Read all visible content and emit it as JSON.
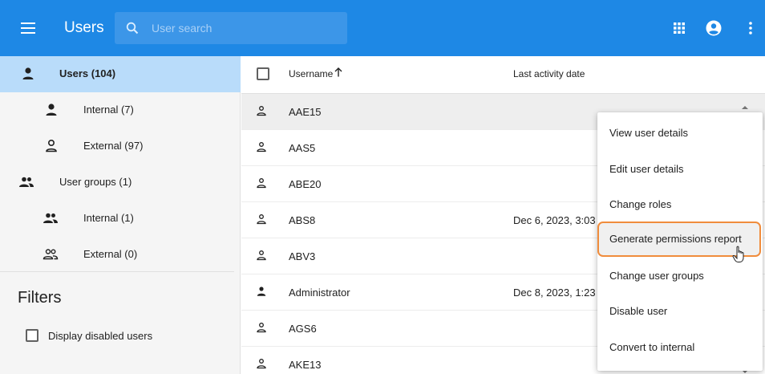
{
  "appbar": {
    "title": "Users",
    "search_placeholder": "User search"
  },
  "sidebar": {
    "items": [
      {
        "label": "Users (104)"
      },
      {
        "label": "Internal (7)"
      },
      {
        "label": "External (97)"
      },
      {
        "label": "User groups (1)"
      },
      {
        "label": "Internal (1)"
      },
      {
        "label": "External (0)"
      }
    ],
    "filters_title": "Filters",
    "filter_disabled_label": "Display disabled users"
  },
  "table": {
    "header_username": "Username",
    "header_activity": "Last activity date",
    "rows": [
      {
        "username": "AAE15",
        "date": ""
      },
      {
        "username": "AAS5",
        "date": ""
      },
      {
        "username": "ABE20",
        "date": ""
      },
      {
        "username": "ABS8",
        "date": "Dec 6, 2023, 3:03"
      },
      {
        "username": "ABV3",
        "date": ""
      },
      {
        "username": "Administrator",
        "date": "Dec 8, 2023, 1:23"
      },
      {
        "username": "AGS6",
        "date": ""
      },
      {
        "username": "AKE13",
        "date": ""
      }
    ]
  },
  "context_menu": {
    "items": [
      {
        "label": "View user details"
      },
      {
        "label": "Edit user details"
      },
      {
        "label": "Change roles"
      },
      {
        "label": "Generate permissions report"
      },
      {
        "label": "Change user groups"
      },
      {
        "label": "Disable user"
      },
      {
        "label": "Convert to internal"
      }
    ]
  },
  "colors": {
    "appbar": "#1e88e5",
    "sidebar_active": "#b9dcfa",
    "highlight_border": "#f08c3c"
  },
  "icons": {
    "menu": "hamburger-icon",
    "search": "search-icon",
    "apps": "apps-grid-icon",
    "account": "account-circle-icon",
    "more": "more-vert-icon",
    "person_filled": "person-icon",
    "person_outline": "person-outline-icon",
    "group": "group-icon",
    "group_outline": "group-outline-icon",
    "sort": "arrow-up-icon"
  }
}
